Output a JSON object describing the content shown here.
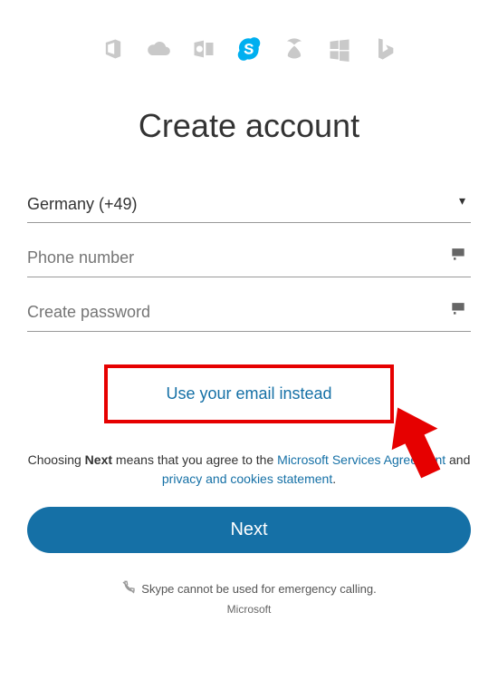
{
  "header": {
    "icons": [
      "office",
      "onedrive",
      "outlook",
      "skype",
      "xbox",
      "windows",
      "bing"
    ]
  },
  "title": "Create account",
  "form": {
    "country": "Germany (+49)",
    "phone_placeholder": "Phone number",
    "password_placeholder": "Create password",
    "email_link": "Use your email instead"
  },
  "consent": {
    "prefix": "Choosing ",
    "bold": "Next",
    "mid": " means that you agree to the ",
    "link1": "Microsoft Services Agreement",
    "and": " and ",
    "link2": "privacy and cookies statement",
    "suffix": "."
  },
  "next_label": "Next",
  "footer": {
    "emergency": "Skype cannot be used for emergency calling.",
    "brand": "Microsoft"
  }
}
